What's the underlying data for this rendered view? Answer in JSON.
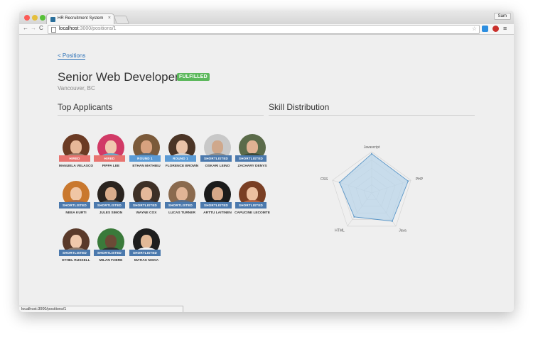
{
  "browser": {
    "tab_title": "HR Recruitment System",
    "tab_close": "×",
    "profile": "Sam",
    "url_host": "localhost",
    "url_path": ":3000/positions/1",
    "nav": {
      "back": "←",
      "forward": "→",
      "reload": "C"
    },
    "star": "☆",
    "menu": "≡",
    "status_url": "localhost:3000/positions/1",
    "icons": [
      "favicon-icon",
      "page-icon",
      "star-icon",
      "extension-icon",
      "shield-icon",
      "menu-icon"
    ]
  },
  "page": {
    "back_link": "< Positions",
    "title": "Senior Web Developer",
    "badge": "FULFILLED",
    "location": "Vancouver, BC",
    "applicants_heading": "Top Applicants",
    "skills_heading": "Skill Distribution"
  },
  "applicants": [
    {
      "name": "MANUELA VELASCO",
      "status": "HIRED",
      "kind": "hired",
      "skin": "#e7b899",
      "hair": "#6b3b24",
      "shirt": "#9b7b6a"
    },
    {
      "name": "PIPPA LEE",
      "status": "HIRED",
      "kind": "hired",
      "skin": "#f1c8ae",
      "hair": "#d13a66",
      "shirt": "#6fa7c4"
    },
    {
      "name": "ETHAN MATHIEU",
      "status": "ROUND 1",
      "kind": "round",
      "skin": "#d8a27f",
      "hair": "#7b5a3a",
      "shirt": "#586a7a"
    },
    {
      "name": "FLORENCE BROWN",
      "status": "ROUND 1",
      "kind": "round",
      "skin": "#eac3a8",
      "hair": "#4b3526",
      "shirt": "#d9d0c8"
    },
    {
      "name": "OSKARI LEINO",
      "status": "SHORTLISTED",
      "kind": "shortlisted",
      "skin": "#cfa88c",
      "hair": "#c8c8c8",
      "shirt": "#8d8d8d"
    },
    {
      "name": "ZACHARY DENYS",
      "status": "SHORTLISTED",
      "kind": "shortlisted",
      "skin": "#e0b293",
      "hair": "#5b6b4a",
      "shirt": "#3c4a3a"
    },
    {
      "name": "NEEA KURTI",
      "status": "SHORTLISTED",
      "kind": "shortlisted",
      "skin": "#f0c6a5",
      "hair": "#c9782e",
      "shirt": "#a86e4c"
    },
    {
      "name": "JULES SIMON",
      "status": "SHORTLISTED",
      "kind": "shortlisted",
      "skin": "#d9ad8c",
      "hair": "#2a241f",
      "shirt": "#565656"
    },
    {
      "name": "WAYNE COX",
      "status": "SHORTLISTED",
      "kind": "shortlisted",
      "skin": "#e4b89a",
      "hair": "#3e3026",
      "shirt": "#40485a"
    },
    {
      "name": "LUCAS TURNER",
      "status": "SHORTLISTED",
      "kind": "shortlisted",
      "skin": "#e1b495",
      "hair": "#8a6a4e",
      "shirt": "#5a6f8a"
    },
    {
      "name": "ARTTU LAITINEN",
      "status": "SHORTLISTED",
      "kind": "shortlisted",
      "skin": "#d5a788",
      "hair": "#1b1b1b",
      "shirt": "#2b2b2b"
    },
    {
      "name": "CAPUCINE LECOMTE",
      "status": "SHORTLISTED",
      "kind": "shortlisted",
      "skin": "#edbf9f",
      "hair": "#7a3f24",
      "shirt": "#b86a4a"
    },
    {
      "name": "ETHEL RUSSELL",
      "status": "SHORTLISTED",
      "kind": "shortlisted",
      "skin": "#f0c9ac",
      "hair": "#5a3a2a",
      "shirt": "#8f7a6b"
    },
    {
      "name": "MILAN FABRE",
      "status": "SHORTLISTED",
      "kind": "shortlisted",
      "skin": "#6b4a36",
      "hair": "#3a7a3a",
      "shirt": "#2f2f2f"
    },
    {
      "name": "MATIAS NISKA",
      "status": "SHORTLISTED",
      "kind": "shortlisted",
      "skin": "#e2b997",
      "hair": "#1e1e1e",
      "shirt": "#f2f2f2"
    }
  ],
  "chart_data": {
    "type": "radar",
    "categories": [
      "Javascript",
      "PHP",
      "Java",
      "HTML",
      "CSS"
    ],
    "values": [
      0.95,
      0.93,
      0.85,
      0.72,
      0.82
    ],
    "rlim": [
      0,
      1
    ],
    "grid": true,
    "colors": {
      "fill": "#b8d4ea",
      "stroke": "#5b97c8",
      "grid": "#d2d2d2"
    }
  }
}
